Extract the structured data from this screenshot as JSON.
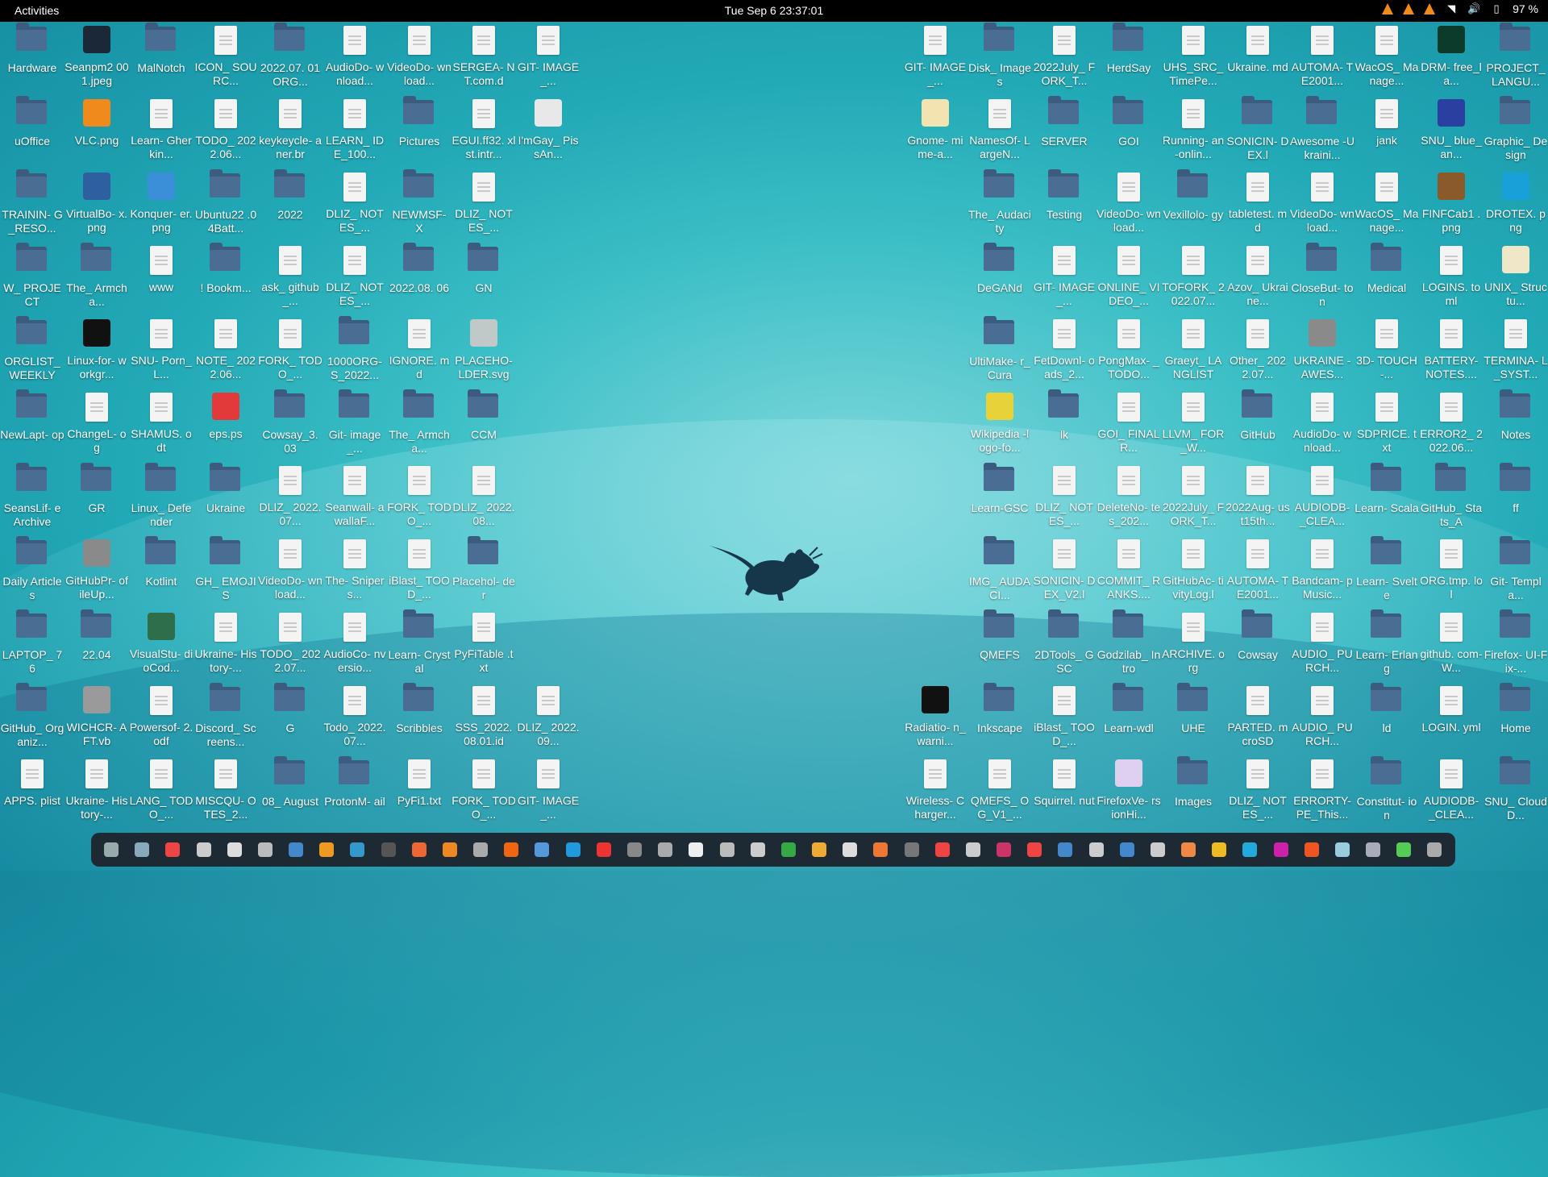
{
  "topbar": {
    "activities": "Activities",
    "clock": "Tue Sep 6  23:37:01",
    "battery": "97 %",
    "tray_icons": [
      "vlc-icon",
      "vlc-icon",
      "vlc-icon",
      "wifi-icon",
      "volume-icon",
      "battery-icon"
    ]
  },
  "left_icons": [
    [
      {
        "label": "Hardware",
        "type": "folder"
      },
      {
        "label": "Seanpm2 001.jpeg",
        "type": "image",
        "color": "#1b2838"
      },
      {
        "label": "MalNotch",
        "type": "folder"
      },
      {
        "label": "ICON_ SOURC...",
        "type": "doc"
      },
      {
        "label": "2022.07. 01ORG...",
        "type": "folder"
      },
      {
        "label": "AudioDo- wnload...",
        "type": "doc"
      },
      {
        "label": "VideoDo- wnload...",
        "type": "doc"
      },
      {
        "label": "SERGEA- NT.com.d",
        "type": "doc"
      },
      {
        "label": "GIT- IMAGE_...",
        "type": "doc"
      }
    ],
    [
      {
        "label": "uOffice",
        "type": "folder"
      },
      {
        "label": "VLC.png",
        "type": "image",
        "color": "#f08a1c"
      },
      {
        "label": "Learn- Gherkin...",
        "type": "doc"
      },
      {
        "label": "TODO_ 2022.06...",
        "type": "doc"
      },
      {
        "label": "keykeycle- aner.br",
        "type": "doc"
      },
      {
        "label": "LEARN_ IDE_100...",
        "type": "doc"
      },
      {
        "label": "Pictures",
        "type": "folder"
      },
      {
        "label": "EGUI.ff32. xlst.intr...",
        "type": "doc"
      },
      {
        "label": "I'mGay_ PissAn...",
        "type": "image",
        "color": "#e8e8e8"
      }
    ],
    [
      {
        "label": "TRAININ- G_RESO...",
        "type": "folder"
      },
      {
        "label": "VirtualBo- x.png",
        "type": "image",
        "color": "#2e5f9e"
      },
      {
        "label": "Konquer- er.png",
        "type": "image",
        "color": "#3a8fd8"
      },
      {
        "label": "Ubuntu22 .04Batt...",
        "type": "folder"
      },
      {
        "label": "2022",
        "type": "folder"
      },
      {
        "label": "DLIZ_ NOTES_...",
        "type": "doc"
      },
      {
        "label": "NEWMSF- X",
        "type": "folder"
      },
      {
        "label": "DLIZ_ NOTES_...",
        "type": "doc"
      }
    ],
    [
      {
        "label": "W_ PROJECT",
        "type": "folder"
      },
      {
        "label": "The_ Armcha...",
        "type": "folder"
      },
      {
        "label": "www",
        "type": "doc"
      },
      {
        "label": "! Bookm...",
        "type": "folder"
      },
      {
        "label": "ask_ github_...",
        "type": "doc"
      },
      {
        "label": "DLIZ_ NOTES_...",
        "type": "doc"
      },
      {
        "label": "2022.08. 06",
        "type": "folder"
      },
      {
        "label": "GN",
        "type": "folder"
      }
    ],
    [
      {
        "label": "ORGLIST_ WEEKLY",
        "type": "folder"
      },
      {
        "label": "Linux-for- workgr...",
        "type": "image",
        "color": "#111111"
      },
      {
        "label": "SNU- Porn_L...",
        "type": "doc"
      },
      {
        "label": "NOTE_ 2022.06...",
        "type": "doc"
      },
      {
        "label": "FORK_ TODO_...",
        "type": "doc"
      },
      {
        "label": "1000ORG- S_2022...",
        "type": "folder"
      },
      {
        "label": "IGNORE. md",
        "type": "doc"
      },
      {
        "label": "PLACEHO- LDER.svg",
        "type": "image",
        "color": "#c0c8c8"
      }
    ],
    [
      {
        "label": "NewLapt- op",
        "type": "folder"
      },
      {
        "label": "ChangeL- og",
        "type": "doc"
      },
      {
        "label": "SHAMUS. odt",
        "type": "doc"
      },
      {
        "label": "eps.ps",
        "type": "image",
        "color": "#e23a3a"
      },
      {
        "label": "Cowsay_3. 03",
        "type": "folder"
      },
      {
        "label": "Git- image_...",
        "type": "folder"
      },
      {
        "label": "The_ Armcha...",
        "type": "folder"
      },
      {
        "label": "CCM",
        "type": "folder"
      }
    ],
    [
      {
        "label": "SeansLif- eArchive",
        "type": "folder"
      },
      {
        "label": "GR",
        "type": "folder"
      },
      {
        "label": "Linux_ Defender",
        "type": "folder"
      },
      {
        "label": "Ukraine",
        "type": "folder"
      },
      {
        "label": "DLIZ_ 2022.07...",
        "type": "doc"
      },
      {
        "label": "Seanwall- awallaF...",
        "type": "doc"
      },
      {
        "label": "FORK_ TODO_...",
        "type": "doc"
      },
      {
        "label": "DLIZ_ 2022.08...",
        "type": "doc"
      }
    ],
    [
      {
        "label": "Daily Articles",
        "type": "folder"
      },
      {
        "label": "GitHubPr- ofileUp...",
        "type": "image",
        "color": "#8a8a8a"
      },
      {
        "label": "Kotlint",
        "type": "folder"
      },
      {
        "label": "GH_ EMOJIS",
        "type": "folder"
      },
      {
        "label": "VideoDo- wnload...",
        "type": "doc"
      },
      {
        "label": "The- Snipers...",
        "type": "doc"
      },
      {
        "label": "iBlast_ TOOD_...",
        "type": "doc"
      },
      {
        "label": "Placehol- der",
        "type": "folder"
      }
    ],
    [
      {
        "label": "LAPTOP_ 76",
        "type": "folder"
      },
      {
        "label": "22.04",
        "type": "folder"
      },
      {
        "label": "VisualStu- dioCod...",
        "type": "image",
        "color": "#2f6e4a"
      },
      {
        "label": "Ukraine- History-...",
        "type": "doc"
      },
      {
        "label": "TODO_ 2022.07...",
        "type": "doc"
      },
      {
        "label": "AudioCo- nversio...",
        "type": "doc"
      },
      {
        "label": "Learn- Crystal",
        "type": "folder"
      },
      {
        "label": "PyFiTable .txt",
        "type": "doc"
      }
    ],
    [
      {
        "label": "GitHub_ Organiz...",
        "type": "folder"
      },
      {
        "label": "WICHCR- AFT.vb",
        "type": "image",
        "color": "#9a9a9a"
      },
      {
        "label": "Powersof- 2.odf",
        "type": "doc"
      },
      {
        "label": "Discord_ Screens...",
        "type": "folder"
      },
      {
        "label": "G",
        "type": "folder"
      },
      {
        "label": "Todo_ 2022.07...",
        "type": "doc"
      },
      {
        "label": "Scribbles",
        "type": "folder"
      },
      {
        "label": "SSS_2022. 08.01.id",
        "type": "doc"
      },
      {
        "label": "DLIZ_ 2022.09...",
        "type": "doc"
      }
    ],
    [
      {
        "label": "APPS. plist",
        "type": "doc"
      },
      {
        "label": "Ukraine- History-...",
        "type": "doc"
      },
      {
        "label": "LANG_ TODO_...",
        "type": "doc"
      },
      {
        "label": "MISCQU- OTES_2...",
        "type": "doc"
      },
      {
        "label": "08_ August",
        "type": "folder"
      },
      {
        "label": "ProtonM- ail",
        "type": "folder"
      },
      {
        "label": "PyFi1.txt",
        "type": "doc"
      },
      {
        "label": "FORK_ TODO_...",
        "type": "doc"
      },
      {
        "label": "GIT- IMAGE_...",
        "type": "doc"
      }
    ]
  ],
  "right_icons": [
    [
      {
        "label": "GIT- IMAGE_...",
        "type": "doc"
      },
      {
        "label": "Disk_ Images",
        "type": "folder"
      },
      {
        "label": "2022July_ FORK_T...",
        "type": "doc"
      },
      {
        "label": "HerdSay",
        "type": "folder"
      },
      {
        "label": "UHS_SRC_ TimePe...",
        "type": "doc"
      },
      {
        "label": "Ukraine. md",
        "type": "doc"
      },
      {
        "label": "AUTOMA- TE2001...",
        "type": "doc"
      },
      {
        "label": "WacOS_ Manage...",
        "type": "doc"
      },
      {
        "label": "DRM- free_la...",
        "type": "image",
        "color": "#0b3b2a"
      },
      {
        "label": "PROJECT_ LANGU...",
        "type": "folder"
      }
    ],
    [
      {
        "label": "Gnome- mime-a...",
        "type": "image",
        "color": "#f3e3b0"
      },
      {
        "label": "NamesOf- LargeN...",
        "type": "doc"
      },
      {
        "label": "SERVER",
        "type": "folder"
      },
      {
        "label": "GOI",
        "type": "folder"
      },
      {
        "label": "Running- an-onlin...",
        "type": "doc"
      },
      {
        "label": "SONICIN- DEX.l",
        "type": "folder"
      },
      {
        "label": "Awesome -Ukraini...",
        "type": "folder"
      },
      {
        "label": "jank",
        "type": "doc"
      },
      {
        "label": "SNU_ blue_an...",
        "type": "image",
        "color": "#2a3fa0"
      },
      {
        "label": "Graphic_ Design",
        "type": "folder"
      }
    ],
    [
      {
        "label": "The_ Audacity",
        "type": "folder"
      },
      {
        "label": "Testing",
        "type": "folder"
      },
      {
        "label": "VideoDo- wnload...",
        "type": "doc"
      },
      {
        "label": "Vexillolo- gy",
        "type": "folder"
      },
      {
        "label": "tabletest. md",
        "type": "doc"
      },
      {
        "label": "VideoDo- wnload...",
        "type": "doc"
      },
      {
        "label": "WacOS_ Manage...",
        "type": "doc"
      },
      {
        "label": "FINFCab1 .png",
        "type": "image",
        "color": "#8b5a2b"
      },
      {
        "label": "DROTEX. png",
        "type": "image",
        "color": "#1aa0d8"
      }
    ],
    [
      {
        "label": "DeGANd",
        "type": "folder"
      },
      {
        "label": "GIT- IMAGE_...",
        "type": "doc"
      },
      {
        "label": "ONLINE_ VIDEO_...",
        "type": "doc"
      },
      {
        "label": "TOFORK_ 2022.07...",
        "type": "doc"
      },
      {
        "label": "Azov_ Ukraine...",
        "type": "doc"
      },
      {
        "label": "CloseBut- ton",
        "type": "folder"
      },
      {
        "label": "Medical",
        "type": "folder"
      },
      {
        "label": "LOGINS. toml",
        "type": "doc"
      },
      {
        "label": "UNIX_ Structu...",
        "type": "image",
        "color": "#f0e6c8"
      }
    ],
    [
      {
        "label": "UltiMake- r_Cura",
        "type": "folder"
      },
      {
        "label": "FetDownl- oads_2...",
        "type": "doc"
      },
      {
        "label": "PongMax- _TODO...",
        "type": "doc"
      },
      {
        "label": "Graeyt_ LANGLIST",
        "type": "doc"
      },
      {
        "label": "Other_ 2022.07...",
        "type": "doc"
      },
      {
        "label": "UKRAINE -AWES...",
        "type": "image",
        "color": "#8a8a8a"
      },
      {
        "label": "3D- TOUCH-...",
        "type": "doc"
      },
      {
        "label": "BATTERY- NOTES....",
        "type": "doc"
      },
      {
        "label": "TERMINA- L_SYST...",
        "type": "doc"
      }
    ],
    [
      {
        "label": "Wikipedia -logo-fo...",
        "type": "image",
        "color": "#e8d23a"
      },
      {
        "label": "lk",
        "type": "folder"
      },
      {
        "label": "GOI_ FINALR...",
        "type": "doc"
      },
      {
        "label": "LLVM_ FOR_W...",
        "type": "doc"
      },
      {
        "label": "GitHub",
        "type": "folder"
      },
      {
        "label": "AudioDo- wnload...",
        "type": "doc"
      },
      {
        "label": "SDPRICE. txt",
        "type": "doc"
      },
      {
        "label": "ERROR2_ 2022.06...",
        "type": "doc"
      },
      {
        "label": "Notes",
        "type": "folder"
      }
    ],
    [
      {
        "label": "Learn-GSC",
        "type": "folder"
      },
      {
        "label": "DLIZ_ NOTES_...",
        "type": "doc"
      },
      {
        "label": "DeleteNo- tes_202...",
        "type": "doc"
      },
      {
        "label": "2022July_ FORK_T...",
        "type": "doc"
      },
      {
        "label": "2022Aug- ust15th...",
        "type": "doc"
      },
      {
        "label": "AUDIODB- _CLEA...",
        "type": "doc"
      },
      {
        "label": "Learn- Scala",
        "type": "folder"
      },
      {
        "label": "GitHub_ Stats_A",
        "type": "folder"
      },
      {
        "label": "ff",
        "type": "folder"
      }
    ],
    [
      {
        "label": "IMG_ AUDACI...",
        "type": "folder"
      },
      {
        "label": "SONICIN- DEX_V2.l",
        "type": "doc"
      },
      {
        "label": "COMMIT_ RANKS....",
        "type": "doc"
      },
      {
        "label": "GitHubAc- tivityLog.l",
        "type": "doc"
      },
      {
        "label": "AUTOMA- TE2001...",
        "type": "doc"
      },
      {
        "label": "Bandcam- pMusic...",
        "type": "doc"
      },
      {
        "label": "Learn- Svelte",
        "type": "folder"
      },
      {
        "label": "ORG.tmp. lol",
        "type": "doc"
      },
      {
        "label": "Git- Templa...",
        "type": "folder"
      }
    ],
    [
      {
        "label": "QMEFS",
        "type": "folder"
      },
      {
        "label": "2DTools_ GSC",
        "type": "folder"
      },
      {
        "label": "Godzilab_ Intro",
        "type": "folder"
      },
      {
        "label": "ARCHIVE. org",
        "type": "doc"
      },
      {
        "label": "Cowsay",
        "type": "folder"
      },
      {
        "label": "AUDIO_ PURCH...",
        "type": "doc"
      },
      {
        "label": "Learn- Erlang",
        "type": "folder"
      },
      {
        "label": "github. com-W...",
        "type": "doc"
      },
      {
        "label": "Firefox- UI-Fix-...",
        "type": "folder"
      }
    ],
    [
      {
        "label": "Radiatio- n_warni...",
        "type": "image",
        "color": "#111111"
      },
      {
        "label": "Inkscape",
        "type": "folder"
      },
      {
        "label": "iBlast_ TOOD_...",
        "type": "doc"
      },
      {
        "label": "Learn-wdl",
        "type": "folder"
      },
      {
        "label": "UHE",
        "type": "folder"
      },
      {
        "label": "PARTED. mcroSD",
        "type": "doc"
      },
      {
        "label": "AUDIO_ PURCH...",
        "type": "doc"
      },
      {
        "label": "ld",
        "type": "folder"
      },
      {
        "label": "LOGIN. yml",
        "type": "doc"
      },
      {
        "label": "Home",
        "type": "folder"
      }
    ],
    [
      {
        "label": "Wireless- Charger...",
        "type": "doc"
      },
      {
        "label": "QMEFS_ OG_V1_...",
        "type": "doc"
      },
      {
        "label": "Squirrel. nut",
        "type": "doc"
      },
      {
        "label": "FirefoxVe- rsionHi...",
        "type": "image",
        "color": "#e0d0f0"
      },
      {
        "label": "Images",
        "type": "folder"
      },
      {
        "label": "DLIZ_ NOTES_...",
        "type": "doc"
      },
      {
        "label": "ERRORTY- PE_This...",
        "type": "doc"
      },
      {
        "label": "Constitut- ion",
        "type": "folder"
      },
      {
        "label": "AUDIODB- _CLEA...",
        "type": "doc"
      },
      {
        "label": "SNU_ CloudD...",
        "type": "folder"
      }
    ]
  ],
  "dock": {
    "apps": [
      "#9aa",
      "#8ab",
      "#e44",
      "#ccc",
      "#ddd",
      "#bbb",
      "#48c",
      "#e92",
      "#39c",
      "#555",
      "#e63",
      "#e82",
      "#aaa",
      "#e61",
      "#59d",
      "#29d",
      "#e33",
      "#888",
      "#aaa",
      "#eee",
      "#bbb",
      "#ccc",
      "#3a4",
      "#ea3",
      "#ddd",
      "#e73",
      "#777",
      "#e44",
      "#ccc",
      "#c36",
      "#e44",
      "#48c",
      "#ccc",
      "#48c",
      "#ccc",
      "#e84",
      "#eb2",
      "#2ad",
      "#c2a",
      "#e52",
      "#9cd",
      "#aab",
      "#5c5",
      "#aaa"
    ]
  }
}
